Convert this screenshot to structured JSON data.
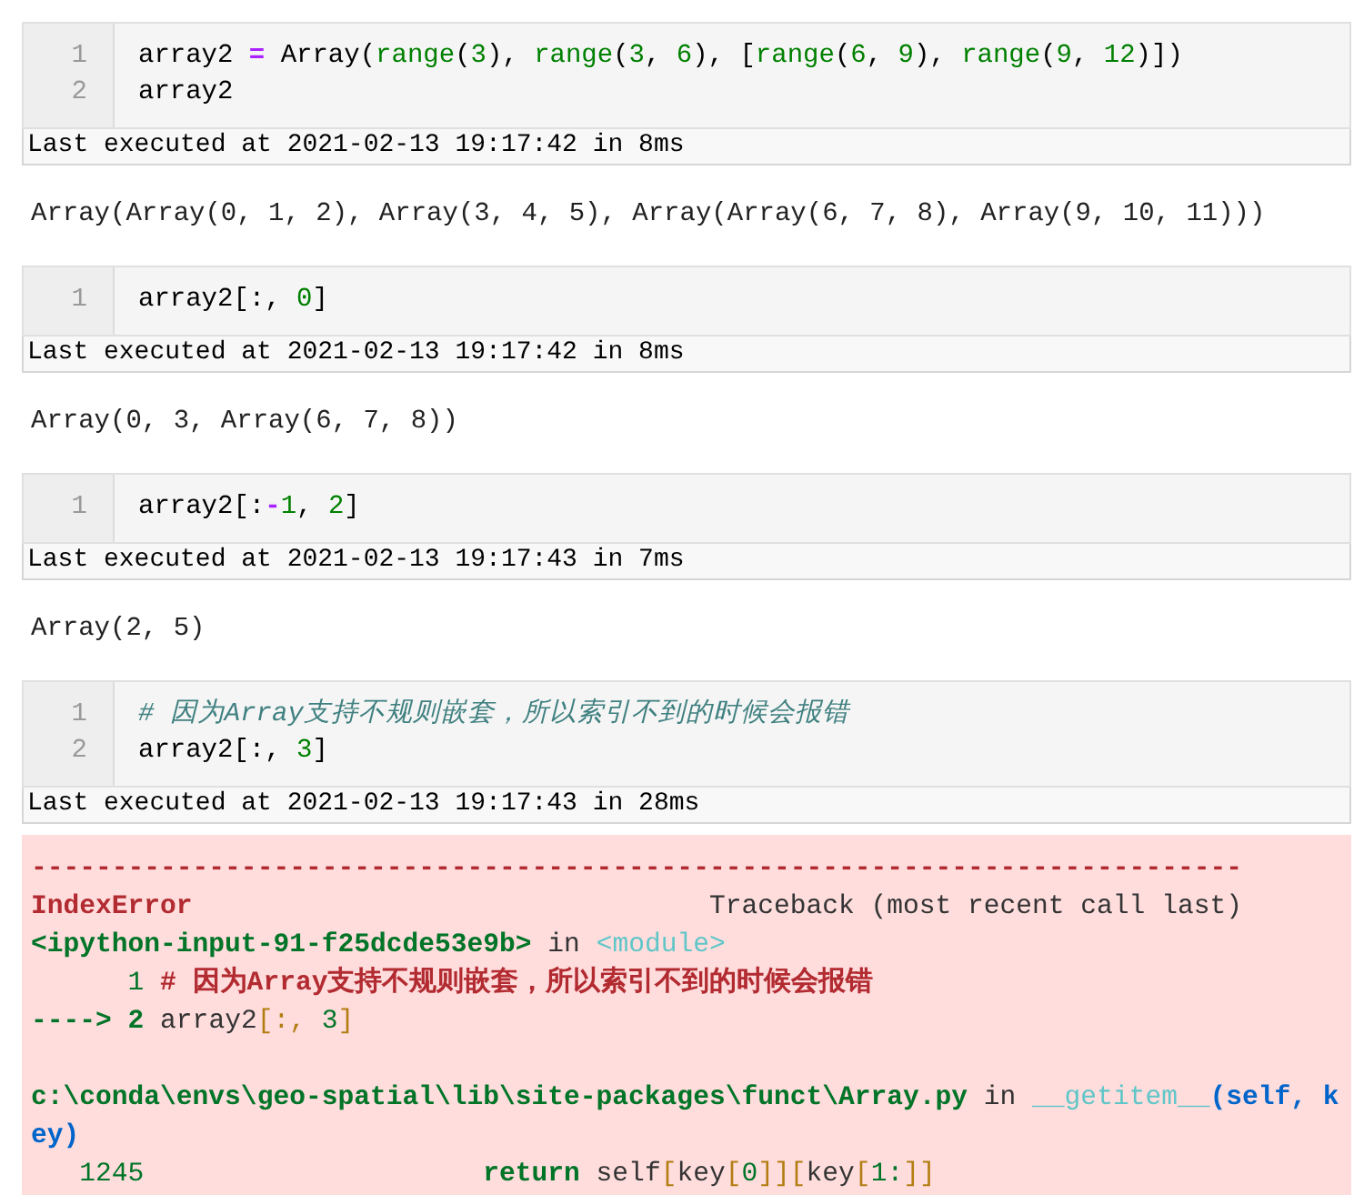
{
  "cells": [
    {
      "input": [
        {
          "number": "1",
          "tokens": [
            {
              "kind": "plain",
              "text": "array2 "
            },
            {
              "kind": "op",
              "text": "="
            },
            {
              "kind": "plain",
              "text": " Array("
            },
            {
              "kind": "builtin",
              "text": "range"
            },
            {
              "kind": "plain",
              "text": "("
            },
            {
              "kind": "num",
              "text": "3"
            },
            {
              "kind": "plain",
              "text": "), "
            },
            {
              "kind": "builtin",
              "text": "range"
            },
            {
              "kind": "plain",
              "text": "("
            },
            {
              "kind": "num",
              "text": "3"
            },
            {
              "kind": "plain",
              "text": ", "
            },
            {
              "kind": "num",
              "text": "6"
            },
            {
              "kind": "plain",
              "text": "), ["
            },
            {
              "kind": "builtin",
              "text": "range"
            },
            {
              "kind": "plain",
              "text": "("
            },
            {
              "kind": "num",
              "text": "6"
            },
            {
              "kind": "plain",
              "text": ", "
            },
            {
              "kind": "num",
              "text": "9"
            },
            {
              "kind": "plain",
              "text": "), "
            },
            {
              "kind": "builtin",
              "text": "range"
            },
            {
              "kind": "plain",
              "text": "("
            },
            {
              "kind": "num",
              "text": "9"
            },
            {
              "kind": "plain",
              "text": ", "
            },
            {
              "kind": "num",
              "text": "12"
            },
            {
              "kind": "plain",
              "text": ")])"
            }
          ]
        },
        {
          "number": "2",
          "tokens": [
            {
              "kind": "plain",
              "text": "array2"
            }
          ]
        }
      ],
      "status": "Last executed at 2021-02-13 19:17:42 in 8ms",
      "output": {
        "kind": "text",
        "text": "Array(Array(0, 1, 2), Array(3, 4, 5), Array(Array(6, 7, 8), Array(9, 10, 11)))"
      }
    },
    {
      "input": [
        {
          "number": "1",
          "tokens": [
            {
              "kind": "plain",
              "text": "array2[:, "
            },
            {
              "kind": "num",
              "text": "0"
            },
            {
              "kind": "plain",
              "text": "]"
            }
          ]
        }
      ],
      "status": "Last executed at 2021-02-13 19:17:42 in 8ms",
      "output": {
        "kind": "text",
        "text": "Array(0, 3, Array(6, 7, 8))"
      }
    },
    {
      "input": [
        {
          "number": "1",
          "tokens": [
            {
              "kind": "plain",
              "text": "array2[:"
            },
            {
              "kind": "op",
              "text": "-"
            },
            {
              "kind": "num",
              "text": "1"
            },
            {
              "kind": "plain",
              "text": ", "
            },
            {
              "kind": "num",
              "text": "2"
            },
            {
              "kind": "plain",
              "text": "]"
            }
          ]
        }
      ],
      "status": "Last executed at 2021-02-13 19:17:43 in 7ms",
      "output": {
        "kind": "text",
        "text": "Array(2, 5)"
      }
    },
    {
      "input": [
        {
          "number": "1",
          "tokens": [
            {
              "kind": "comment",
              "text": "# 因为Array支持不规则嵌套，所以索引不到的时候会报错"
            }
          ]
        },
        {
          "number": "2",
          "tokens": [
            {
              "kind": "plain",
              "text": "array2[:, "
            },
            {
              "kind": "num",
              "text": "3"
            },
            {
              "kind": "plain",
              "text": "]"
            }
          ]
        }
      ],
      "status": "Last executed at 2021-02-13 19:17:43 in 28ms",
      "output": {
        "kind": "error",
        "lines": [
          {
            "kind": "text",
            "tokens": [
              {
                "kind": "red",
                "text": "---------------------------------------------------------------------------"
              }
            ]
          },
          {
            "kind": "text",
            "tokens": [
              {
                "kind": "red",
                "text": "IndexError"
              },
              {
                "kind": "tplain",
                "text": "                                Traceback (most recent call last)"
              }
            ]
          },
          {
            "kind": "text",
            "tokens": [
              {
                "kind": "green",
                "text": "<ipython-input-91-f25dcde53e9b>"
              },
              {
                "kind": "tplain",
                "text": " in "
              },
              {
                "kind": "cyan",
                "text": "<module>"
              }
            ]
          },
          {
            "kind": "text",
            "tokens": [
              {
                "kind": "lineno",
                "text": "      1"
              },
              {
                "kind": "red",
                "text": " # 因为Array支持不规则嵌套，所以索引不到的时候会报错"
              }
            ]
          },
          {
            "kind": "text",
            "tokens": [
              {
                "kind": "green",
                "text": "----> 2"
              },
              {
                "kind": "tplain",
                "text": " array2"
              },
              {
                "kind": "yellow",
                "text": "[:, "
              },
              {
                "kind": "teal",
                "text": "3"
              },
              {
                "kind": "yellow",
                "text": "]"
              }
            ]
          },
          {
            "kind": "blank"
          },
          {
            "kind": "text",
            "tokens": [
              {
                "kind": "green",
                "text": "c:\\conda\\envs\\geo-spatial\\lib\\site-packages\\funct\\Array.py"
              },
              {
                "kind": "tplain",
                "text": " in "
              },
              {
                "kind": "cyan",
                "text": "__getitem__"
              },
              {
                "kind": "blue",
                "text": "(self, k"
              }
            ]
          },
          {
            "kind": "text",
            "tokens": [
              {
                "kind": "blue",
                "text": "ey)"
              }
            ]
          },
          {
            "kind": "text",
            "tokens": [
              {
                "kind": "lineno",
                "text": "   1245                     "
              },
              {
                "kind": "green",
                "text": "return"
              },
              {
                "kind": "tplain",
                "text": " self"
              },
              {
                "kind": "yellow",
                "text": "["
              },
              {
                "kind": "tplain",
                "text": "key"
              },
              {
                "kind": "yellow",
                "text": "["
              },
              {
                "kind": "teal",
                "text": "0"
              },
              {
                "kind": "yellow",
                "text": "]]["
              },
              {
                "kind": "tplain",
                "text": "key"
              },
              {
                "kind": "yellow",
                "text": "["
              },
              {
                "kind": "teal",
                "text": "1:"
              },
              {
                "kind": "yellow",
                "text": "]]"
              }
            ]
          }
        ]
      }
    }
  ]
}
